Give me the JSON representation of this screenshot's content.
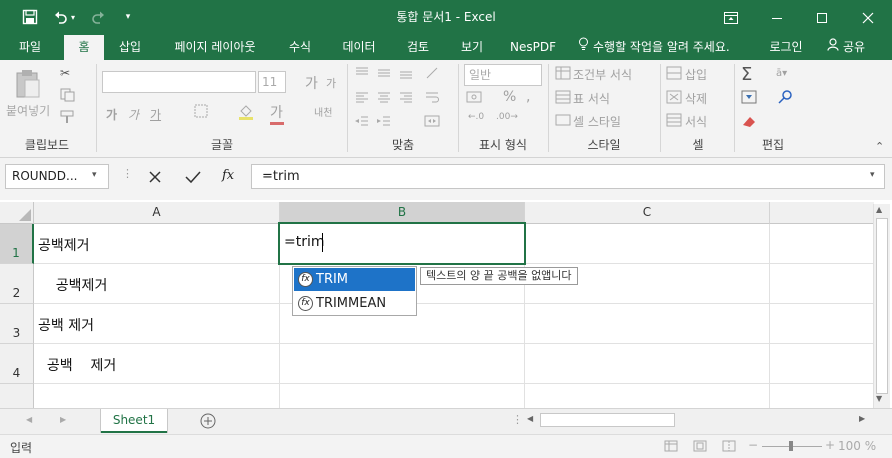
{
  "window": {
    "title": "통합 문서1 - Excel"
  },
  "tabs": [
    "파일",
    "홈",
    "삽입",
    "페이지 레이아웃",
    "수식",
    "데이터",
    "검토",
    "보기",
    "NesPDF"
  ],
  "tell_me": "수행할 작업을 알려 주세요.",
  "login": "로그인",
  "share": "공유",
  "ribbon": {
    "clipboard": {
      "paste": "붙여넣기",
      "label": "클립보드"
    },
    "font": {
      "size": "11",
      "label": "글꼴",
      "bold": "가",
      "italic": "가",
      "underline": "가",
      "grow": "가",
      "shrink": "가",
      "phonetic": "내천"
    },
    "align": {
      "label": "맞춤"
    },
    "number": {
      "format": "일반",
      "label": "표시 형식",
      "percent": "%"
    },
    "styles": {
      "conditional": "조건부 서식",
      "table": "표 서식",
      "cell": "셀 스타일",
      "label": "스타일"
    },
    "cells": {
      "insert": "삽입",
      "delete": "삭제",
      "format": "서식",
      "label": "셀"
    },
    "editing": {
      "label": "편집"
    }
  },
  "formula_bar": {
    "name_box": "ROUNDD...",
    "formula": "=trim"
  },
  "columns": [
    "A",
    "B",
    "C"
  ],
  "rows": [
    {
      "num": "1",
      "a": "공백제거"
    },
    {
      "num": "2",
      "a": "    공백제거"
    },
    {
      "num": "3",
      "a": "공백 제거"
    },
    {
      "num": "4",
      "a": "  공백    제거"
    }
  ],
  "edit_cell": {
    "text": "=trim"
  },
  "autocomplete": {
    "items": [
      "TRIM",
      "TRIMMEAN"
    ],
    "tooltip": "텍스트의 양 끝 공백을 없앱니다"
  },
  "sheets": [
    "Sheet1"
  ],
  "status": {
    "mode": "입력",
    "zoom": "100 %"
  },
  "colors": {
    "accent": "#217346",
    "selection": "#1e73c8"
  }
}
